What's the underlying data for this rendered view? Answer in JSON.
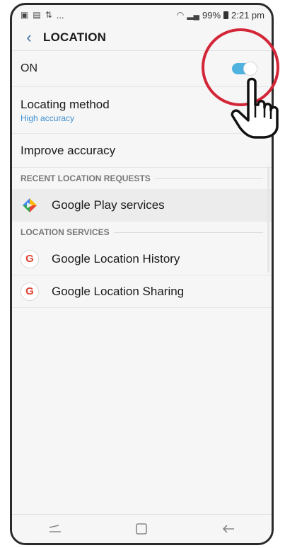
{
  "status_bar": {
    "left_icons": [
      "image-icon",
      "flipboard-icon",
      "signal-boost-icon"
    ],
    "ellipsis": "...",
    "battery": "99%",
    "time": "2:21 pm"
  },
  "header": {
    "title": "LOCATION",
    "back_icon": "chevron-left-icon"
  },
  "master_toggle": {
    "label": "ON",
    "state": true
  },
  "locating_method": {
    "title": "Locating method",
    "value": "High accuracy"
  },
  "improve_accuracy": {
    "label": "Improve accuracy"
  },
  "recent_requests": {
    "header": "RECENT LOCATION REQUESTS",
    "items": [
      {
        "label": "Google Play services",
        "icon": "google-play-services-icon"
      }
    ]
  },
  "location_services": {
    "header": "LOCATION SERVICES",
    "items": [
      {
        "label": "Google Location History",
        "icon": "google-g-icon"
      },
      {
        "label": "Google Location Sharing",
        "icon": "google-g-icon"
      }
    ]
  },
  "nav_bar": {
    "buttons": [
      "recents-icon",
      "home-icon",
      "back-icon"
    ]
  },
  "colors": {
    "accent_blue": "#3e8fd0",
    "toggle_on": "#4fb3e0",
    "highlight_red": "#d32638"
  }
}
